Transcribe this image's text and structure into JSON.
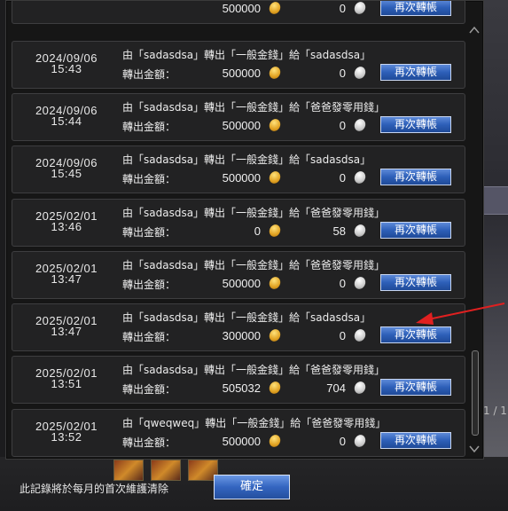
{
  "background": {
    "top_name": "qweqweq",
    "side_text": "1 / 1"
  },
  "rows": [
    {
      "date": "",
      "time": "",
      "desc": "",
      "gold": "500000",
      "silver": "0",
      "button": "再次轉帳"
    },
    {
      "date": "2024/09/06",
      "time": "15:43",
      "desc": "由「sadasdsa」轉出「一般金錢」給「sadasdsa」",
      "amount_label": "轉出金額：",
      "gold": "500000",
      "silver": "0",
      "button": "再次轉帳"
    },
    {
      "date": "2024/09/06",
      "time": "15:44",
      "desc": "由「sadasdsa」轉出「一般金錢」給「爸爸發零用錢」",
      "amount_label": "轉出金額：",
      "gold": "500000",
      "silver": "0",
      "button": "再次轉帳"
    },
    {
      "date": "2024/09/06",
      "time": "15:45",
      "desc": "由「sadasdsa」轉出「一般金錢」給「sadasdsa」",
      "amount_label": "轉出金額：",
      "gold": "500000",
      "silver": "0",
      "button": "再次轉帳"
    },
    {
      "date": "2025/02/01",
      "time": "13:46",
      "desc": "由「sadasdsa」轉出「一般金錢」給「爸爸發零用錢」",
      "amount_label": "轉出金額：",
      "gold": "0",
      "silver": "58",
      "button": "再次轉帳"
    },
    {
      "date": "2025/02/01",
      "time": "13:47",
      "desc": "由「sadasdsa」轉出「一般金錢」給「爸爸發零用錢」",
      "amount_label": "轉出金額：",
      "gold": "500000",
      "silver": "0",
      "button": "再次轉帳"
    },
    {
      "date": "2025/02/01",
      "time": "13:47",
      "desc": "由「sadasdsa」轉出「一般金錢」給「sadasdsa」",
      "amount_label": "轉出金額：",
      "gold": "300000",
      "silver": "0",
      "button": "再次轉帳"
    },
    {
      "date": "2025/02/01",
      "time": "13:51",
      "desc": "由「sadasdsa」轉出「一般金錢」給「爸爸發零用錢」",
      "amount_label": "轉出金額：",
      "gold": "505032",
      "silver": "704",
      "button": "再次轉帳"
    },
    {
      "date": "2025/02/01",
      "time": "13:52",
      "desc": "由「qweqweq」轉出「一般金錢」給「爸爸發零用錢」",
      "amount_label": "轉出金額：",
      "gold": "500000",
      "silver": "0",
      "button": "再次轉帳"
    }
  ],
  "footer": {
    "note": "此記錄將於每月的首次維護清除",
    "confirm": "確定"
  },
  "colors": {
    "button_blue": "#2d5fb8",
    "annotation_arrow": "#e02020",
    "gold_coin": "#e0a020",
    "silver_coin": "#c8c8c8"
  },
  "icons": [
    "gold-coin-icon",
    "silver-coin-icon",
    "scroll-up-icon",
    "scroll-down-icon",
    "annotation-arrow-icon"
  ]
}
